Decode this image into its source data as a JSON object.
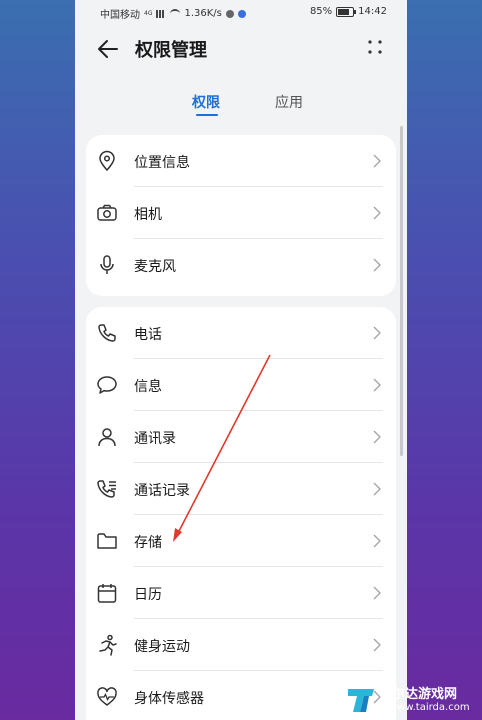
{
  "status_bar": {
    "carrier": "中国移动",
    "network_badge": "4G",
    "speed": "1.36K/s",
    "battery": "85%",
    "time": "14:42"
  },
  "header": {
    "title": "权限管理"
  },
  "tabs": [
    {
      "label": "权限",
      "active": true
    },
    {
      "label": "应用",
      "active": false
    }
  ],
  "groups": [
    {
      "items": [
        {
          "label": "位置信息",
          "icon": "location-pin-icon"
        },
        {
          "label": "相机",
          "icon": "camera-icon"
        },
        {
          "label": "麦克风",
          "icon": "microphone-icon"
        }
      ]
    },
    {
      "items": [
        {
          "label": "电话",
          "icon": "phone-icon"
        },
        {
          "label": "信息",
          "icon": "message-bubble-icon"
        },
        {
          "label": "通讯录",
          "icon": "contact-person-icon"
        },
        {
          "label": "通话记录",
          "icon": "call-log-icon"
        },
        {
          "label": "存储",
          "icon": "folder-icon"
        },
        {
          "label": "日历",
          "icon": "calendar-icon"
        },
        {
          "label": "健身运动",
          "icon": "running-person-icon"
        },
        {
          "label": "身体传感器",
          "icon": "heart-rate-icon"
        }
      ]
    }
  ],
  "colors": {
    "accent": "#1f6fd8",
    "annotation_arrow": "#e03a2e",
    "background_top": "#3a6fb0",
    "background_bottom": "#6a2aa0"
  },
  "watermark": {
    "title": "泰尔达游戏网",
    "url": "www.tairda.com"
  }
}
